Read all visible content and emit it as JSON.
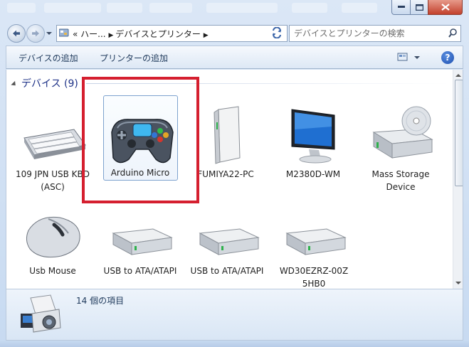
{
  "window": {
    "controls": {
      "minimize_icon": "minimize-icon",
      "maximize_icon": "maximize-icon",
      "close_icon": "close-icon"
    }
  },
  "nav": {
    "address_prefix": "«",
    "address_path": "ハー...",
    "address_current": "デバイスとプリンター",
    "search_placeholder": "デバイスとプリンターの検索"
  },
  "commands": {
    "add_device": "デバイスの追加",
    "add_printer": "プリンターの追加",
    "help": "?"
  },
  "group": {
    "label": "デバイス (9)"
  },
  "devices": [
    {
      "label": "109 JPN USB KBD (ASC)",
      "icon": "keyboard-icon"
    },
    {
      "label": "Arduino Micro",
      "icon": "gamepad-icon"
    },
    {
      "label": "FUMIYA22-PC",
      "icon": "pc-tower-icon"
    },
    {
      "label": "M2380D-WM",
      "icon": "monitor-icon"
    },
    {
      "label": "Mass Storage Device",
      "icon": "mass-storage-icon"
    },
    {
      "label": "Usb Mouse",
      "icon": "mouse-icon"
    },
    {
      "label": "USB to ATA/ATAPI",
      "icon": "hard-drive-icon"
    },
    {
      "label": "USB to ATA/ATAPI",
      "icon": "hard-drive-icon"
    },
    {
      "label": "WD30EZRZ-00Z 5HB0",
      "icon": "hard-drive-icon"
    }
  ],
  "details": {
    "count_text": "14 個の項目",
    "icon": "printer-devices-icon"
  },
  "colors": {
    "highlight": "#d51f2f",
    "group_text": "#1e3287"
  }
}
